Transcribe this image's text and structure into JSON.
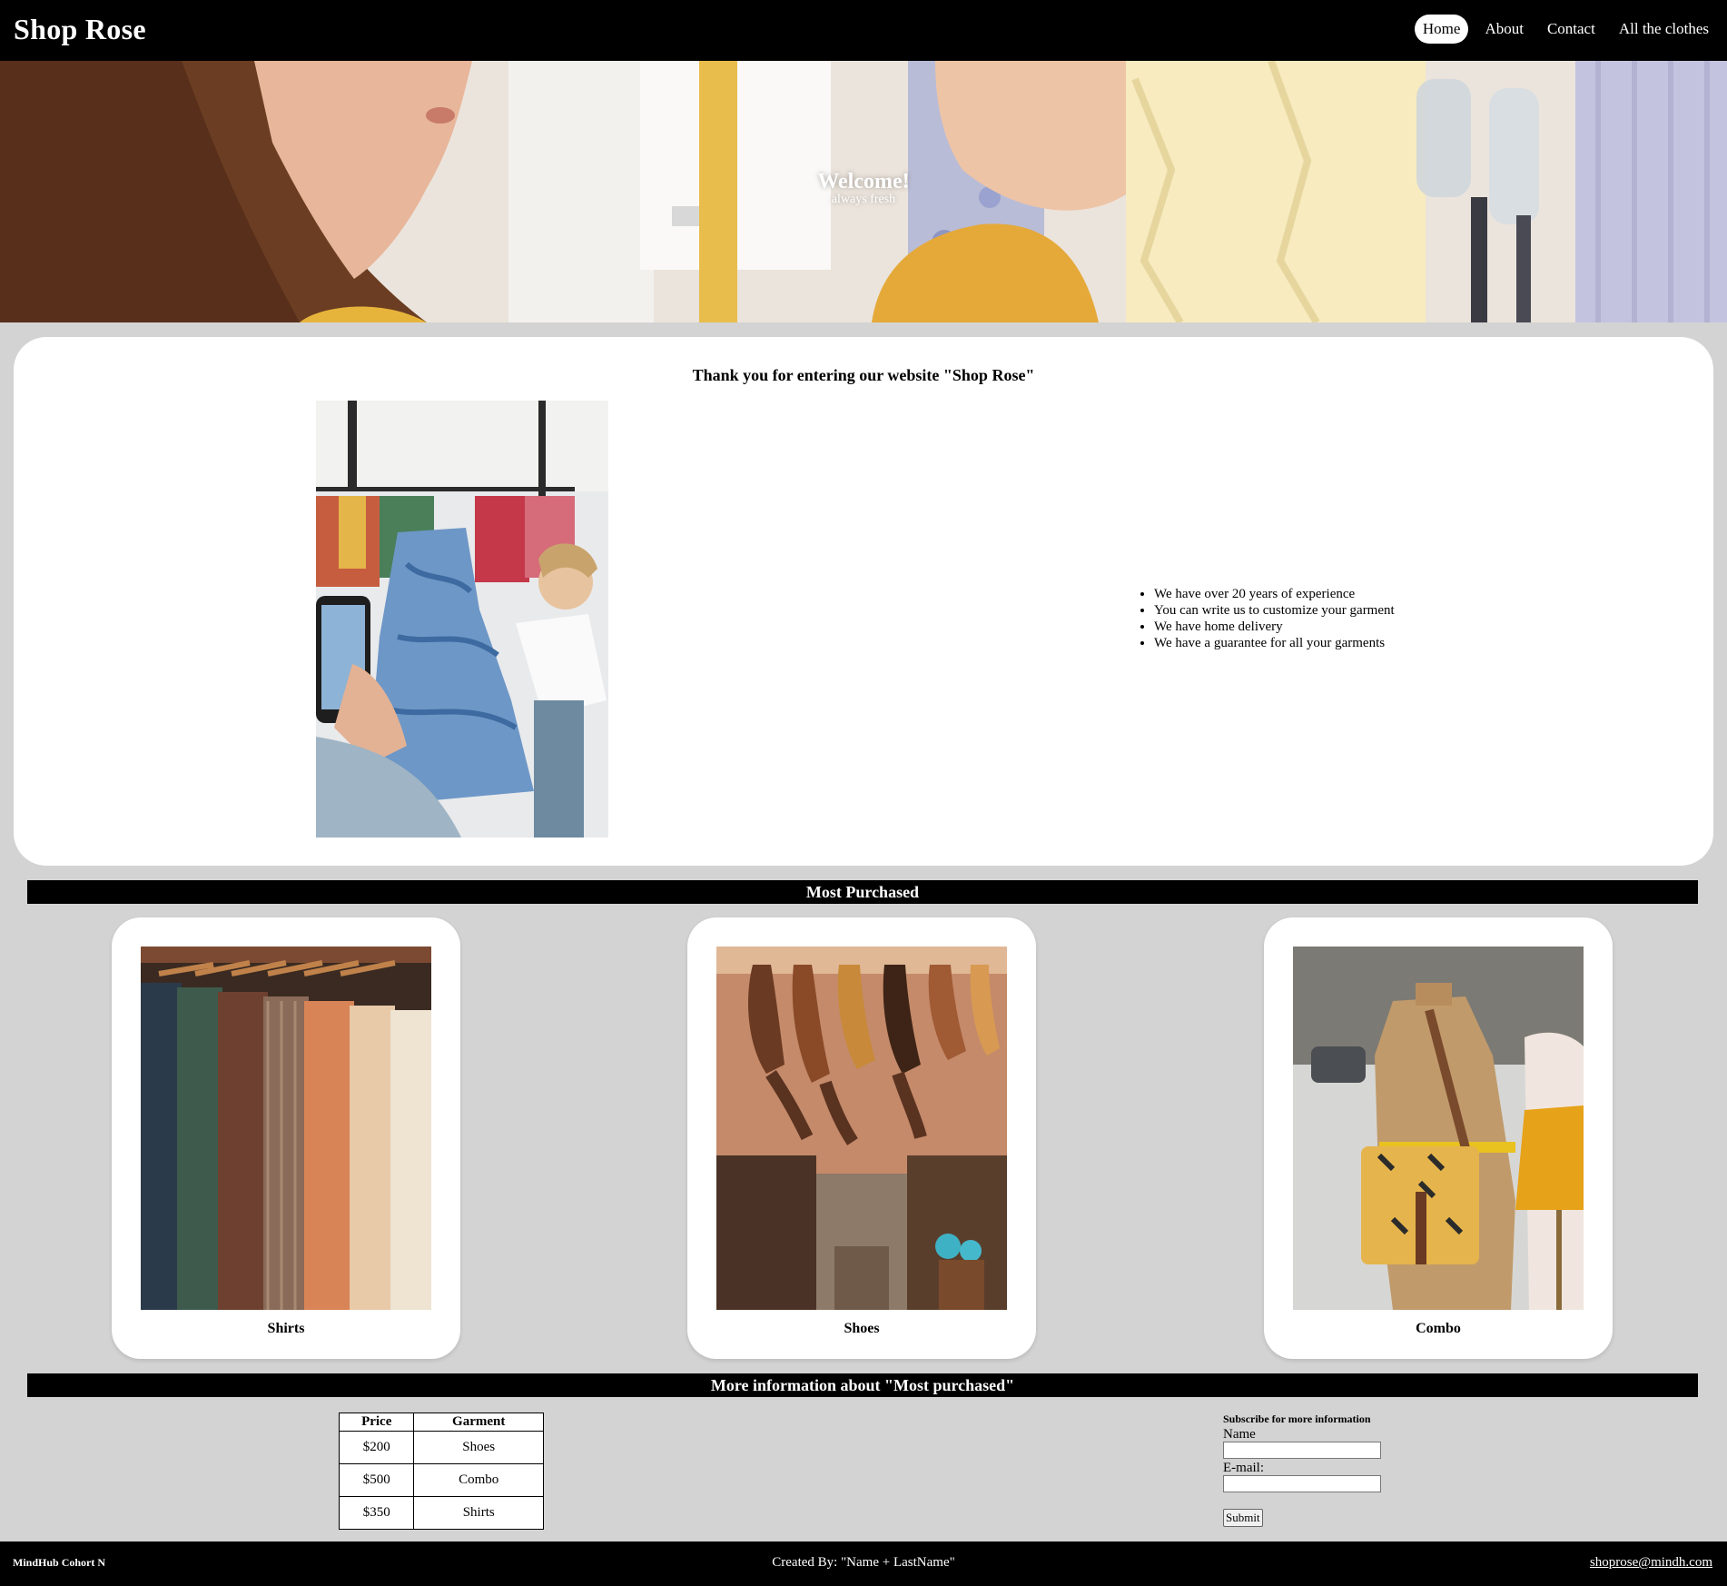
{
  "header": {
    "brand": "Shop Rose",
    "nav": [
      "Home",
      "About",
      "Contact",
      "All the clothes"
    ]
  },
  "hero": {
    "title": "Welcome!",
    "subtitle": "always fresh"
  },
  "intro": {
    "title": "Thank you for entering our website \"Shop Rose\"",
    "features": [
      "We have over 20 years of experience",
      "You can write us to customize your garment",
      "We have home delivery",
      "We have a guarantee for all your garments"
    ]
  },
  "most_purchased": {
    "heading": "Most Purchased",
    "items": [
      "Shirts",
      "Shoes",
      "Combo"
    ]
  },
  "more_info": {
    "heading": "More information about \"Most purchased\"",
    "table": {
      "headers": [
        "Price",
        "Garment"
      ],
      "rows": [
        [
          "$200",
          "Shoes"
        ],
        [
          "$500",
          "Combo"
        ],
        [
          "$350",
          "Shirts"
        ]
      ]
    }
  },
  "subscribe": {
    "legend": "Subscribe for more information",
    "name_label": "Name",
    "email_label": "E-mail:",
    "submit_label": "Submit"
  },
  "footer": {
    "left": "MindHub Cohort N",
    "center": "Created By: \"Name + LastName\"",
    "email": "shoprose@mindh.com"
  }
}
